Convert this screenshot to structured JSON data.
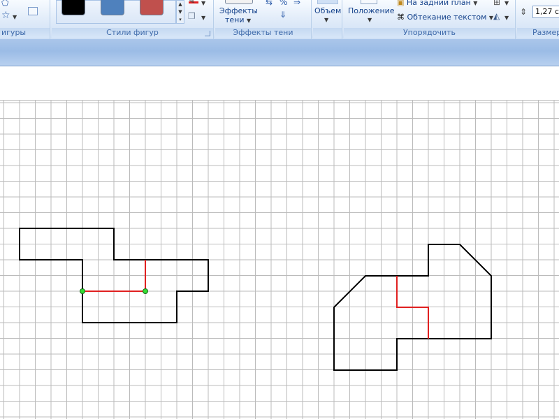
{
  "ribbon": {
    "groups": {
      "shapes_label": "игуры",
      "shape_styles_label": "Стили фигур",
      "shadow_effects": {
        "button_line1": "Эффекты",
        "button_line2": "тени",
        "label": "Эффекты тени"
      },
      "volume": {
        "button": "Объем"
      },
      "arrange": {
        "position_button": "Положение",
        "send_back": "На задний план",
        "text_wrap": "Обтекание текстом",
        "label": "Упорядочить"
      },
      "size": {
        "value": "1,27 с",
        "label": "Размер"
      }
    },
    "style_swatches": [
      {
        "name": "black",
        "color": "#000000"
      },
      {
        "name": "blue",
        "color": "#4f81bd"
      },
      {
        "name": "red",
        "color": "#c0504d"
      }
    ]
  },
  "drawing": {
    "grid_color": "#bbbbbb",
    "outline_color": "#000000",
    "cut_color": "#e02020",
    "handle_color": "#33dd33"
  }
}
